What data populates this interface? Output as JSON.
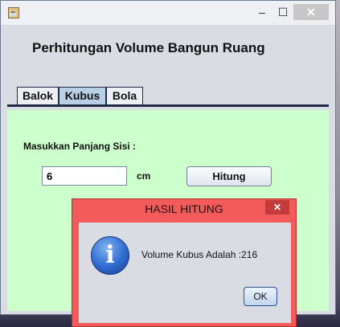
{
  "window": {
    "title": "",
    "controls": {
      "minimize": "‒",
      "maximize": "☐",
      "close": "✕"
    }
  },
  "app": {
    "heading": "Perhitungan Volume Bangun Ruang",
    "tabs": [
      {
        "label": "Balok",
        "selected": false
      },
      {
        "label": "Kubus",
        "selected": true
      },
      {
        "label": "Bola",
        "selected": false
      }
    ],
    "kubus": {
      "side_label": "Masukkan Panjang Sisi :",
      "side_value": "6",
      "unit": "cm",
      "calculate_label": "Hitung"
    }
  },
  "dialog": {
    "title": "HASIL HITUNG",
    "close": "✕",
    "message": "Volume Kubus Adalah :216",
    "ok_label": "OK",
    "icon": "info-icon"
  },
  "colors": {
    "panel_bg": "#ccffcc",
    "dialog_frame": "#f35b5b",
    "selected_tab": "#b8cfe6"
  }
}
